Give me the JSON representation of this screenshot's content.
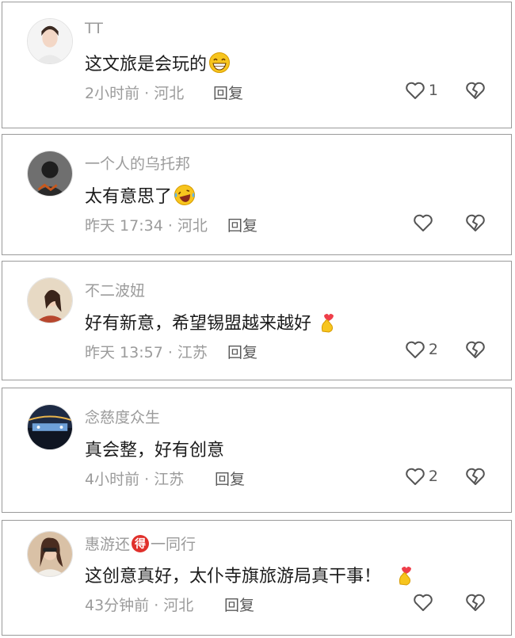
{
  "comments": [
    {
      "username": "TT",
      "text": "这文旅是会玩的",
      "emoji": "grinning-emoji",
      "time_location": "2小时前 · 河北",
      "reply_label": "回复",
      "likes": "1"
    },
    {
      "username": "一个人的乌托邦",
      "text": "太有意思了",
      "emoji": "laughing-tears-emoji",
      "time_location": "昨天 17:34 · 河北",
      "reply_label": "回复",
      "likes": ""
    },
    {
      "username": "不二波妞",
      "text": "好有新意，希望锡盟越来越好",
      "emoji": "finger-heart-emoji",
      "time_location": "昨天 13:57 · 江苏",
      "reply_label": "回复",
      "likes": "2"
    },
    {
      "username": "念慈度众生",
      "text": "真会整，好有创意",
      "emoji": "",
      "time_location": "4小时前 · 江苏",
      "reply_label": "回复",
      "likes": "2"
    },
    {
      "username": "惠游还",
      "badge": "得",
      "username_suffix": "一同行",
      "text": "这创意真好，太仆寺旗旅游局真干事！",
      "emoji": "finger-heart-emoji",
      "time_location": "43分钟前 · 河北",
      "reply_label": "回复",
      "likes": ""
    }
  ],
  "colors": {
    "meta_text": "#9b9b9b",
    "icon_stroke": "#555555",
    "badge": "#e0302b",
    "emoji_yellow": "#f7c51e"
  }
}
